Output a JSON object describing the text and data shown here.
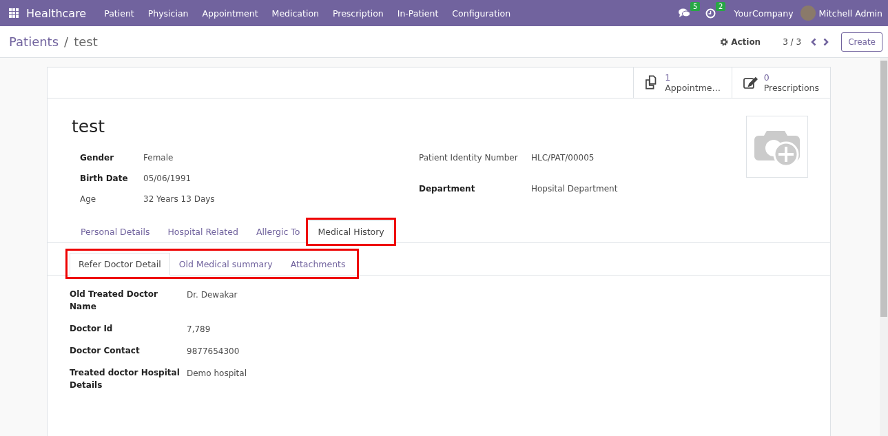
{
  "navbar": {
    "app": "Healthcare",
    "menus": [
      "Patient",
      "Physician",
      "Appointment",
      "Medication",
      "Prescription",
      "In-Patient",
      "Configuration"
    ],
    "messages_count": "5",
    "activities_count": "2",
    "company": "YourCompany",
    "user": "Mitchell Admin"
  },
  "control_panel": {
    "breadcrumb": "Patients",
    "separator": "/",
    "record": "test",
    "action": "Action",
    "pager": "3 / 3",
    "create": "Create"
  },
  "smart_buttons": [
    {
      "kind": "copies",
      "count": "1",
      "label": "Appointme…"
    },
    {
      "kind": "edit",
      "count": "0",
      "label": "Prescriptions"
    }
  ],
  "record": {
    "name": "test",
    "left_fields": [
      {
        "label": "Gender",
        "value": "Female",
        "required": true
      },
      {
        "label": "Birth Date",
        "value": "05/06/1991",
        "required": true
      },
      {
        "label": "Age",
        "value": "32 Years 13 Days",
        "required": false
      }
    ],
    "right_fields": [
      {
        "label": "Patient Identity Number",
        "value": "HLC/PAT/00005",
        "required": false
      },
      {
        "label": "Department",
        "value": "Hopsital Department",
        "required": true
      }
    ]
  },
  "tabs": [
    {
      "label": "Personal Details",
      "selected": false,
      "highlighted": false
    },
    {
      "label": "Hospital Related",
      "selected": false,
      "highlighted": false
    },
    {
      "label": "Allergic To",
      "selected": false,
      "highlighted": false
    },
    {
      "label": "Medical History",
      "selected": true,
      "highlighted": true
    }
  ],
  "sub_tabs": {
    "highlighted": true,
    "items": [
      {
        "label": "Refer Doctor Detail",
        "selected": true
      },
      {
        "label": "Old Medical summary",
        "selected": false
      },
      {
        "label": "Attachments",
        "selected": false
      }
    ]
  },
  "detail_fields": [
    {
      "label": "Old Treated Doctor Name",
      "value": "Dr. Dewakar"
    },
    {
      "label": "Doctor Id",
      "value": "7,789"
    },
    {
      "label": "Doctor Contact",
      "value": "9877654300"
    },
    {
      "label": "Treated doctor Hospital Details",
      "value": "Demo hospital"
    }
  ]
}
